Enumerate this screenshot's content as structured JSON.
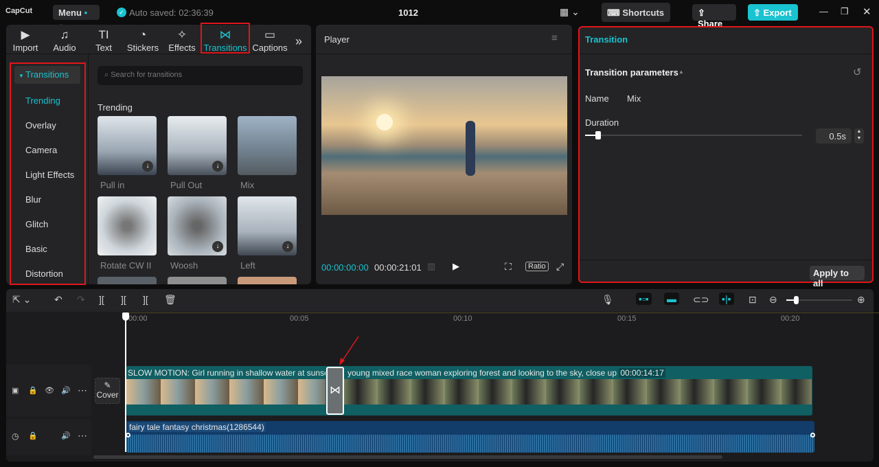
{
  "app": {
    "logo": "CapCut",
    "menu": "Menu",
    "autosave": "Auto saved: 02:36:39",
    "project": "1012",
    "shortcuts": "Shortcuts",
    "share": "Share",
    "export": "Export"
  },
  "toolbar_tabs": [
    {
      "label": "Import",
      "icon": "▶"
    },
    {
      "label": "Audio",
      "icon": "♫"
    },
    {
      "label": "Text",
      "icon": "TI"
    },
    {
      "label": "Stickers",
      "icon": "◔"
    },
    {
      "label": "Effects",
      "icon": "✧"
    },
    {
      "label": "Transitions",
      "icon": "⋈"
    },
    {
      "label": "Captions",
      "icon": "▭"
    }
  ],
  "sidebar": {
    "header": "Transitions",
    "items": [
      "Trending",
      "Overlay",
      "Camera",
      "Light Effects",
      "Blur",
      "Glitch",
      "Basic",
      "Distortion"
    ]
  },
  "search": {
    "placeholder": "Search for transitions"
  },
  "section": "Trending",
  "transitions": [
    "Pull in",
    "Pull Out",
    "Mix",
    "Rotate CW II",
    "Woosh",
    "Left"
  ],
  "player": {
    "title": "Player",
    "current": "00:00:00:00",
    "total": "00:00:21:01",
    "ratio": "Ratio"
  },
  "inspector": {
    "tab": "Transition",
    "section": "Transition parameters",
    "name_label": "Name",
    "name_value": "Mix",
    "duration_label": "Duration",
    "duration_value": "0.5s",
    "duration_fraction": 0.06,
    "apply_all": "Apply to all"
  },
  "timeline": {
    "ticks": [
      "00:00",
      "00:05",
      "00:10",
      "00:15",
      "00:20"
    ],
    "cover": "Cover",
    "clip1": "SLOW MOTION: Girl running in shallow water at sunset",
    "clip2": "young mixed race woman exploring forest and looking to the sky, close up",
    "clip2_duration": "00:00:14:17",
    "audio": "fairy tale fantasy christmas(1286544)",
    "zoom_fraction": 0.15
  },
  "colors": {
    "accent": "#19c3d0",
    "red": "#e0161b",
    "clip": "#0f5f63",
    "audio": "#123c6a"
  }
}
